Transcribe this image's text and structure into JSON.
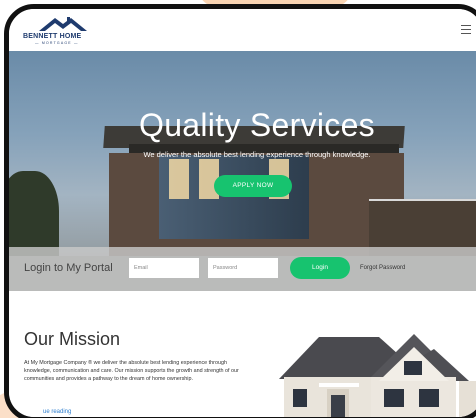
{
  "logo": {
    "name": "BENNETT HOME",
    "sub": "— MORTGAGE —"
  },
  "hero": {
    "title": "Quality Services",
    "subtitle": "We deliver the absolute best lending experience through knowledge.",
    "apply_label": "APPLY NOW"
  },
  "portal": {
    "title": "Login to My Portal",
    "email_placeholder": "Email",
    "password_placeholder": "Password",
    "login_label": "Login",
    "forgot_label": "Forgot Password"
  },
  "mission": {
    "title": "Our Mission",
    "body": "At My Mortgage Company ® we deliver the absolute best lending experience through knowledge, communication and care. Our mission supports the growth and strength of our communities and provides a pathway to the dream of home ownership.",
    "link_label": "ue reading"
  },
  "colors": {
    "accent_green": "#17c36f",
    "brand_navy": "#1f3b6e",
    "link_blue": "#2f7fcf"
  }
}
